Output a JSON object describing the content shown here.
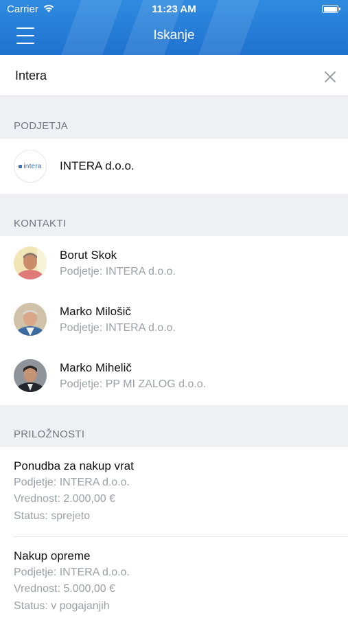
{
  "status_bar": {
    "carrier": "Carrier",
    "time": "11:23 AM"
  },
  "nav": {
    "title": "Iskanje",
    "menu_icon": "hamburger-menu-icon"
  },
  "search": {
    "value": "Intera",
    "clear_icon": "close-icon"
  },
  "sections": {
    "companies": {
      "header": "PODJETJA",
      "items": [
        {
          "name": "INTERA d.o.o.",
          "logo_text": "intera"
        }
      ]
    },
    "contacts": {
      "header": "KONTAKTI",
      "items": [
        {
          "name": "Borut Skok",
          "company": "Podjetje: INTERA d.o.o."
        },
        {
          "name": "Marko Milošič",
          "company": "Podjetje: INTERA d.o.o."
        },
        {
          "name": "Marko Mihelič",
          "company": "Podjetje: PP MI ZALOG d.o.o."
        }
      ]
    },
    "opportunities": {
      "header": "PRILOŽNOSTI",
      "items": [
        {
          "title": "Ponudba za nakup vrat",
          "company": "Podjetje: INTERA d.o.o.",
          "value": "Vrednost: 2.000,00 €",
          "status": "Status: sprejeto"
        },
        {
          "title": "Nakup opreme",
          "company": "Podjetje: INTERA d.o.o.",
          "value": "Vrednost: 5.000,00 €",
          "status": "Status: v pogajanjih"
        }
      ]
    }
  },
  "colors": {
    "header_blue": "#1f72cf",
    "section_bg": "#eef0f3",
    "secondary_text": "#9aa1a8"
  }
}
